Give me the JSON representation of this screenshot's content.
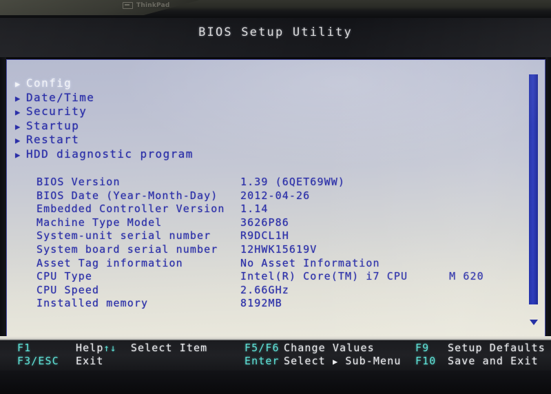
{
  "bezel": {
    "logo_text": "ThinkPad",
    "logo_icon": "thinkpad-logo-icon"
  },
  "header": {
    "title": "BIOS Setup Utility"
  },
  "menu": {
    "arrow_glyph": "▶",
    "items": [
      {
        "label": "Config",
        "selected": true
      },
      {
        "label": "Date/Time",
        "selected": false
      },
      {
        "label": "Security",
        "selected": false
      },
      {
        "label": "Startup",
        "selected": false
      },
      {
        "label": "Restart",
        "selected": false
      },
      {
        "label": "HDD diagnostic program",
        "selected": false
      }
    ]
  },
  "info": {
    "rows": [
      {
        "label": "BIOS Version",
        "value": "1.39   (6QET69WW)"
      },
      {
        "label": "BIOS Date (Year-Month-Day)",
        "value": "2012-04-26"
      },
      {
        "label": "Embedded Controller Version",
        "value": "1.14"
      },
      {
        "label": "Machine Type Model",
        "value": "3626P86"
      },
      {
        "label": "System-unit serial number",
        "value": "R9DCL1H"
      },
      {
        "label": "System board serial number",
        "value": "12HWK15619V"
      },
      {
        "label": "Asset Tag information",
        "value": "No Asset Information"
      },
      {
        "label": "CPU Type",
        "value": "Intel(R) Core(TM) i7 CPU",
        "value2": "M 620"
      },
      {
        "label": "CPU Speed",
        "value": "2.66GHz"
      },
      {
        "label": "Installed memory",
        "value": "8192MB"
      }
    ]
  },
  "scrollbar": {
    "down_arrow_glyph": "▼"
  },
  "footer": {
    "row1": {
      "key1": "F1",
      "desc1": "Help",
      "arrows": "↑↓",
      "desc1b": "Select Item",
      "key2": "F5/F6",
      "desc2": "Change Values",
      "key3": "F9",
      "desc3": "Setup Defaults"
    },
    "row2": {
      "key1": "F3/ESC",
      "desc1": "Exit",
      "key2": "Enter",
      "desc2a": "Select",
      "submenu_arrow": "▶",
      "desc2b": "Sub-Menu",
      "key3": "F10",
      "desc3": "Save and Exit"
    }
  },
  "colors": {
    "bios_blue": "#2b2fa8",
    "selected_white": "#f2f3f7",
    "footer_key_cyan": "#5fe3d8",
    "footer_desc_white": "#e9eaec",
    "panel_bg_top": "#b6bbd0",
    "panel_bg_bottom": "#ebe9dd",
    "panel_border": "#4a4fa8",
    "scrollbar_blue": "#2a39bb"
  }
}
